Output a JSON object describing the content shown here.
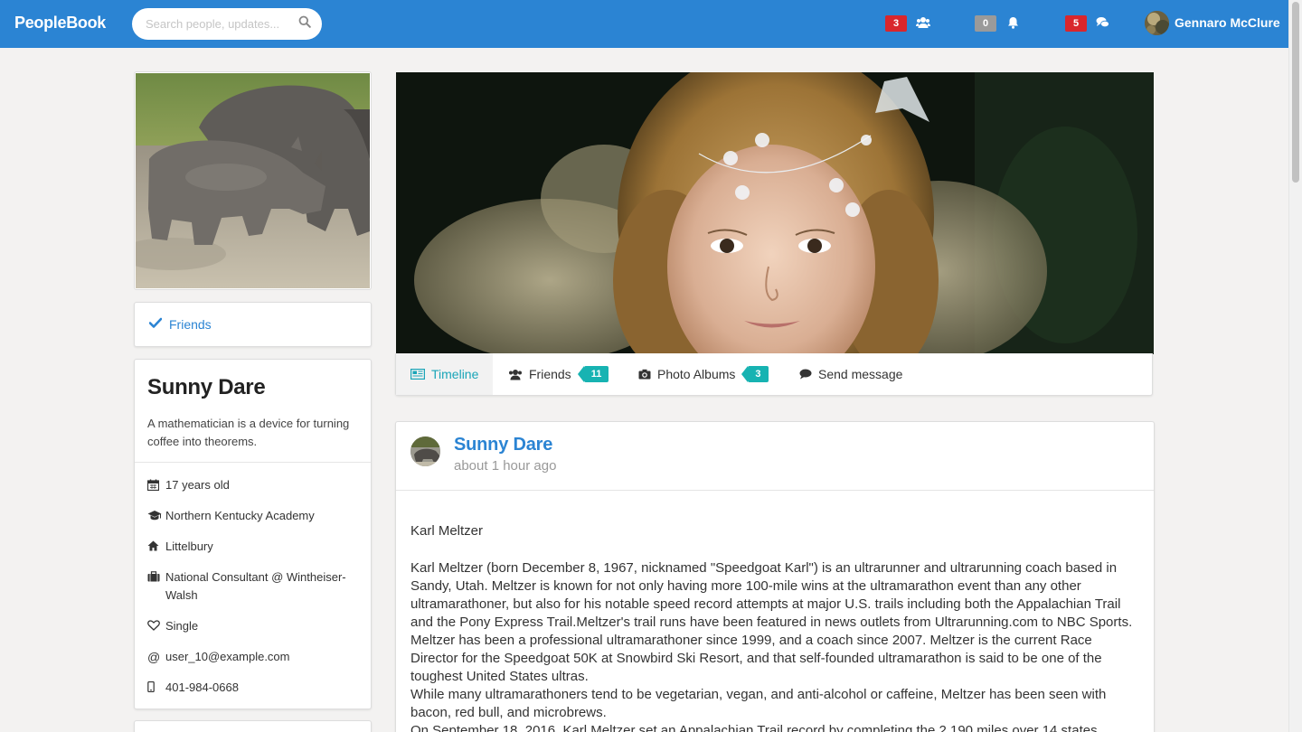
{
  "brand": "PeopleBook",
  "search": {
    "placeholder": "Search people, updates..."
  },
  "navbar": {
    "friend_requests_count": "3",
    "notifications_count": "0",
    "messages_count": "5",
    "user_name": "Gennaro McClure",
    "colors": {
      "bar": "#2b84d3",
      "badge_active": "#d9262c",
      "badge_zero": "#9a9a9a"
    }
  },
  "sidebar": {
    "friends_button": "Friends",
    "profile": {
      "name": "Sunny Dare",
      "bio": "A mathematician is a device for turning coffee into theorems.",
      "details": [
        {
          "icon": "calendar-icon",
          "text": "17 years old"
        },
        {
          "icon": "graduation-cap-icon",
          "text": "Northern Kentucky Academy"
        },
        {
          "icon": "home-icon",
          "text": "Littelbury"
        },
        {
          "icon": "briefcase-icon",
          "text": "National Consultant @ Wintheiser-Walsh"
        },
        {
          "icon": "heart-icon",
          "text": "Single"
        },
        {
          "icon": "at-icon",
          "text": "user_10@example.com"
        },
        {
          "icon": "mobile-phone-icon",
          "text": "401-984-0668"
        }
      ]
    }
  },
  "tabs": [
    {
      "label": "Timeline",
      "active": true
    },
    {
      "label": "Friends",
      "badge": "11"
    },
    {
      "label": "Photo Albums",
      "badge": "3"
    },
    {
      "label": "Send message"
    }
  ],
  "tab_badge_color": "#17b3b2",
  "post": {
    "author": "Sunny Dare",
    "time": "about 1 hour ago",
    "title": "Karl Meltzer",
    "paragraphs": [
      "Karl Meltzer (born December 8, 1967, nicknamed \"Speedgoat Karl\") is an ultrarunner and ultrarunning coach based in Sandy, Utah. Meltzer is known for not only having more 100-mile wins at the ultramarathon event than any other ultramarathoner, but also for his notable speed record attempts at major U.S. trails including both the Appalachian Trail and the Pony Express Trail.Meltzer's trail runs have been featured in news outlets from Ultrarunning.com to NBC Sports. Meltzer has been a professional ultramarathoner since 1999, and a coach since 2007. Meltzer is the current Race Director for the Speedgoat 50K at Snowbird Ski Resort, and that self-founded ultramarathon is said to be one of the toughest United States ultras.",
      "While many ultramarathoners tend to be vegetarian, vegan, and anti-alcohol or caffeine, Meltzer has been seen with bacon, red bull, and microbrews.",
      "On September 18, 2016, Karl Meltzer set an Appalachian Trail record by completing the 2,190 miles over 14 states"
    ]
  }
}
